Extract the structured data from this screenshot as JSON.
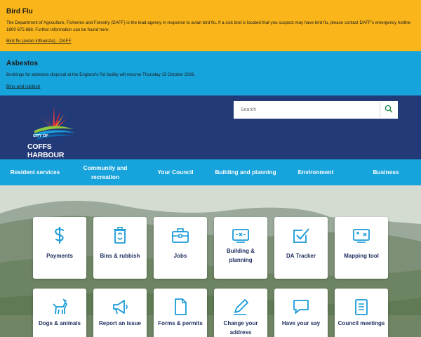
{
  "alerts": [
    {
      "title": "Bird Flu",
      "body": "The Department of Agriculture, Fisheries and Forestry (DAFF) is the lead agency in response to avian bird flu. If a sick bird is located that you suspect may have bird flu, please contact DAFF's emergency hotline 1800 675 888. Further information can be found here:",
      "link": "Bird flu (avian influenza) - DAFF",
      "color": "#f9b51a"
    },
    {
      "title": "Asbestos",
      "body": "Bookings for asbestos disposal at the England's Rd facility will resume Thursday 15 October 2026.",
      "link": "Bins and rubbish",
      "color": "#17a3db"
    }
  ],
  "header": {
    "logo_city": "CITY OF",
    "logo_name": "COFFS HARBOUR",
    "search_placeholder": "Search",
    "background": "#233a78"
  },
  "nav": [
    "Resident services",
    "Community and recreation",
    "Your Council",
    "Building and planning",
    "Environment",
    "Business"
  ],
  "tiles": [
    {
      "label": "Payments",
      "icon": "dollar-icon"
    },
    {
      "label": "Bins & rubbish",
      "icon": "recycle-bin-icon"
    },
    {
      "label": "Jobs",
      "icon": "briefcase-icon"
    },
    {
      "label": "Building & planning",
      "icon": "building-plan-icon"
    },
    {
      "label": "DA Tracker",
      "icon": "checkbox-icon"
    },
    {
      "label": "Mapping tool",
      "icon": "map-tool-icon"
    },
    {
      "label": "Dogs & animals",
      "icon": "dog-icon"
    },
    {
      "label": "Report an issue",
      "icon": "megaphone-icon"
    },
    {
      "label": "Forms & permits",
      "icon": "document-icon"
    },
    {
      "label": "Change your address",
      "icon": "pencil-icon"
    },
    {
      "label": "Have your say",
      "icon": "speech-bubble-icon"
    },
    {
      "label": "Council meetings",
      "icon": "clipboard-list-icon"
    }
  ],
  "colors": {
    "accent": "#17a3db",
    "navy": "#233a78",
    "tile_text": "#1d2c5e",
    "icon": "#1a9bd7"
  }
}
